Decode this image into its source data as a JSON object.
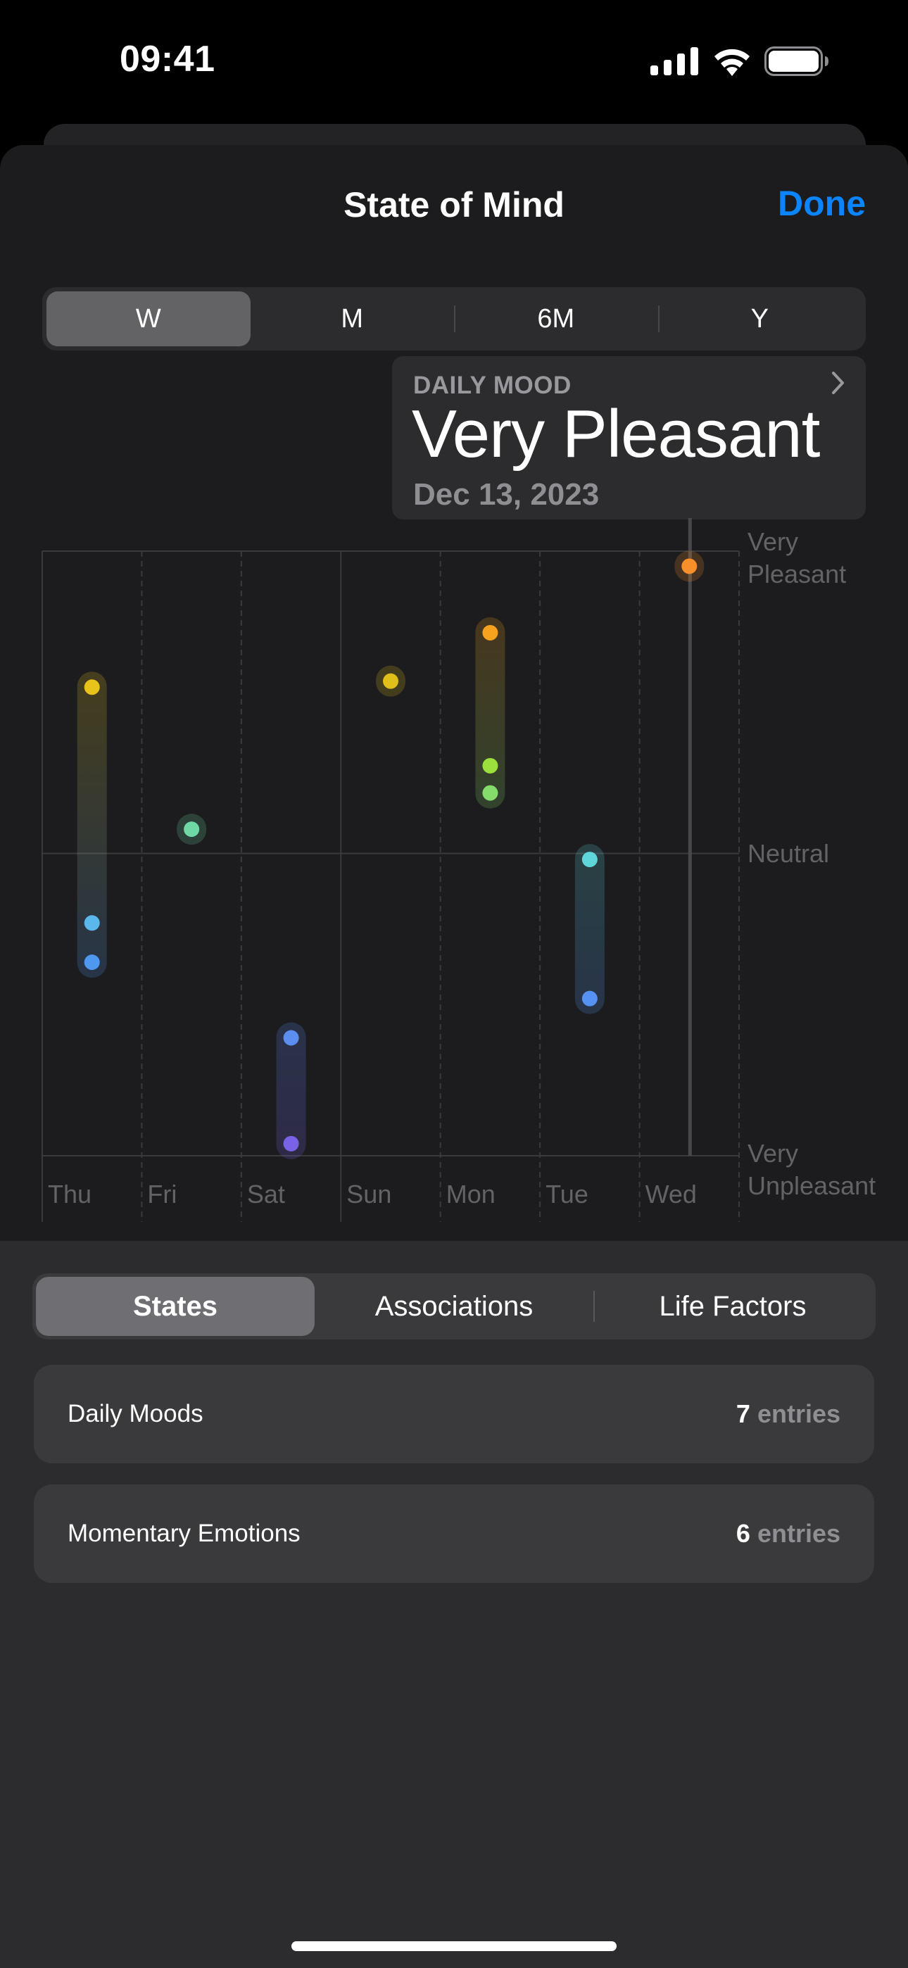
{
  "status_bar": {
    "time": "09:41",
    "icons": [
      "cellular-signal-icon",
      "wifi-icon",
      "battery-icon"
    ]
  },
  "nav": {
    "title": "State of Mind",
    "done_label": "Done",
    "accent_color": "#0a84ff"
  },
  "period_selector": {
    "options": [
      "W",
      "M",
      "6M",
      "Y"
    ],
    "selected": "W"
  },
  "callout": {
    "label": "DAILY MOOD",
    "value": "Very Pleasant",
    "date": "Dec 13, 2023",
    "icon": "chevron-right-icon"
  },
  "chart_data": {
    "type": "scatter",
    "title": "",
    "xlabel": "",
    "ylabel": "",
    "categories": [
      "Thu",
      "Fri",
      "Sat",
      "Sun",
      "Mon",
      "Tue",
      "Wed"
    ],
    "y_tick_labels": [
      {
        "value": 1,
        "lines": [
          "Very",
          "Pleasant"
        ]
      },
      {
        "value": 0,
        "lines": [
          "Neutral"
        ]
      },
      {
        "value": -1,
        "lines": [
          "Very",
          "Unpleasant"
        ]
      }
    ],
    "ylim": [
      -1,
      1
    ],
    "grid": true,
    "selected_category": "Wed",
    "points": [
      {
        "day": "Thu",
        "value": 0.55,
        "color": "#e8c31a"
      },
      {
        "day": "Thu",
        "value": -0.23,
        "color": "#5ab8ec"
      },
      {
        "day": "Thu",
        "value": -0.36,
        "color": "#4f98f0"
      },
      {
        "day": "Fri",
        "value": 0.08,
        "color": "#6fd9a6"
      },
      {
        "day": "Sat",
        "value": -0.61,
        "color": "#5b8ef0"
      },
      {
        "day": "Sat",
        "value": -0.96,
        "color": "#7a62e6"
      },
      {
        "day": "Sun",
        "value": 0.57,
        "color": "#e0bf1a"
      },
      {
        "day": "Mon",
        "value": 0.73,
        "color": "#f7a21e"
      },
      {
        "day": "Mon",
        "value": 0.29,
        "color": "#9be03c"
      },
      {
        "day": "Mon",
        "value": 0.2,
        "color": "#86dc6a"
      },
      {
        "day": "Tue",
        "value": -0.02,
        "color": "#5fd6da"
      },
      {
        "day": "Tue",
        "value": -0.48,
        "color": "#5592f2"
      },
      {
        "day": "Wed",
        "value": 0.95,
        "color": "#f78f2a"
      }
    ]
  },
  "states_tabs": {
    "options": [
      "States",
      "Associations",
      "Life Factors"
    ],
    "selected": "States"
  },
  "rows": [
    {
      "title": "Daily Moods",
      "count": "7",
      "unit": "entries"
    },
    {
      "title": "Momentary Emotions",
      "count": "6",
      "unit": "entries"
    }
  ]
}
